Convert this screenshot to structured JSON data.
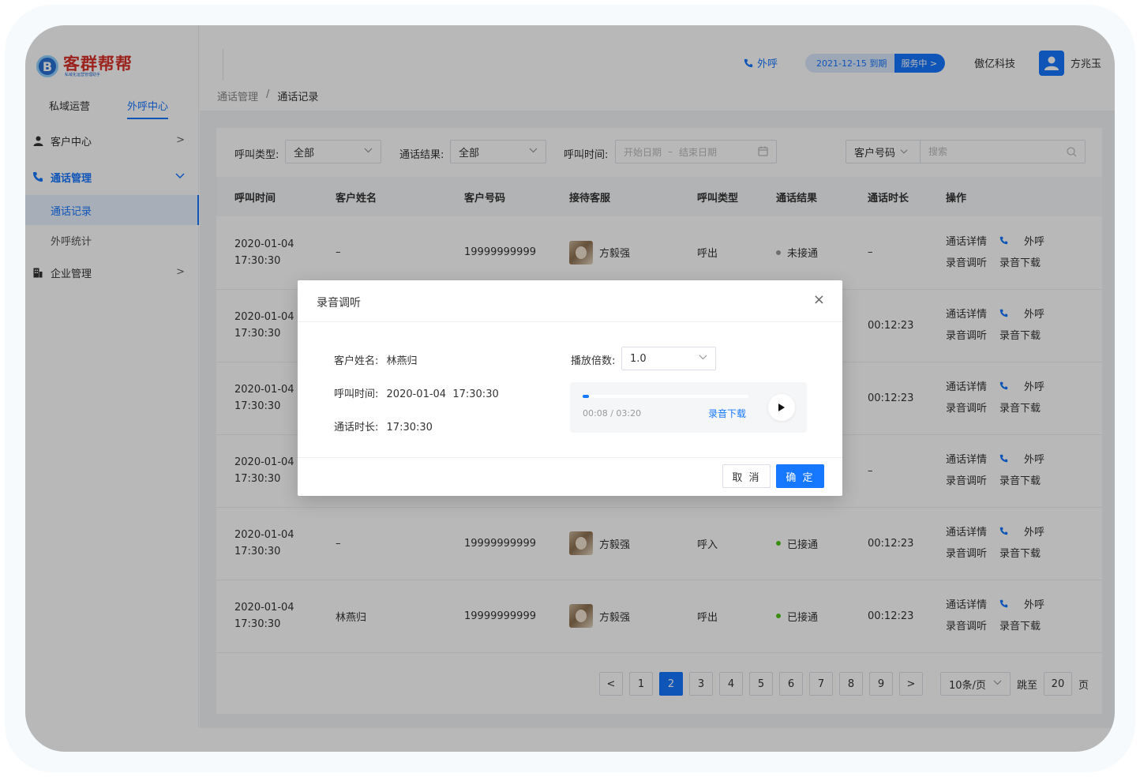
{
  "brand": {
    "title": "客群帮帮",
    "subtitle": "私域化运营管理助手",
    "mark": "B"
  },
  "top_tabs": [
    {
      "label": "私域运营"
    },
    {
      "label": "外呼中心"
    }
  ],
  "menu": {
    "customer_center": "客户中心",
    "call_management": "通话管理",
    "call_records": "通话记录",
    "outbound_stats": "外呼统计",
    "enterprise_management": "企业管理"
  },
  "header": {
    "call_label": "外呼",
    "expire_text": "2021-12-15  到期",
    "service_label": "服务中 >",
    "company": "傲亿科技",
    "user": "方兆玉"
  },
  "breadcrumb": {
    "parent": "通话管理",
    "sep": "/",
    "current": "通话记录"
  },
  "filters": {
    "call_type_label": "呼叫类型:",
    "call_type_value": "全部",
    "result_label": "通话结果:",
    "result_value": "全部",
    "time_label": "呼叫时间:",
    "start_placeholder": "开始日期",
    "date_sep": "–",
    "end_placeholder": "结束日期",
    "search_type": "客户号码",
    "search_placeholder": "搜索"
  },
  "table": {
    "columns": [
      "呼叫时间",
      "客户姓名",
      "客户号码",
      "接待客服",
      "呼叫类型",
      "通话结果",
      "通话时长",
      "操作"
    ],
    "rows": [
      {
        "date": "2020-01-04",
        "time": "17:30:30",
        "name": "–",
        "phone": "19999999999",
        "agent": "方毅强",
        "type": "呼出",
        "result": "未接通",
        "result_color": "#999999",
        "duration": "–"
      },
      {
        "date": "2020-01-04",
        "time": "17:30:30",
        "name": "",
        "phone": "",
        "agent": "",
        "type": "",
        "result": "",
        "result_color": "",
        "duration": "00:12:23"
      },
      {
        "date": "2020-01-04",
        "time": "17:30:30",
        "name": "",
        "phone": "",
        "agent": "",
        "type": "",
        "result": "",
        "result_color": "",
        "duration": "00:12:23"
      },
      {
        "date": "2020-01-04",
        "time": "17:30:30",
        "name": "",
        "phone": "",
        "agent": "",
        "type": "",
        "result": "",
        "result_color": "",
        "duration": "–"
      },
      {
        "date": "2020-01-04",
        "time": "17:30:30",
        "name": "–",
        "phone": "19999999999",
        "agent": "方毅强",
        "type": "呼入",
        "result": "已接通",
        "result_color": "#52c41a",
        "duration": "00:12:23"
      },
      {
        "date": "2020-01-04",
        "time": "17:30:30",
        "name": "林燕归",
        "phone": "19999999999",
        "agent": "方毅强",
        "type": "呼出",
        "result": "已接通",
        "result_color": "#52c41a",
        "duration": "00:12:23"
      }
    ],
    "actions": {
      "detail": "通话详情",
      "call": "外呼",
      "listen": "录音调听",
      "download": "录音下载"
    }
  },
  "pagination": {
    "prev": "<",
    "next": ">",
    "pages": [
      "1",
      "2",
      "3",
      "4",
      "5",
      "6",
      "7",
      "8",
      "9"
    ],
    "current": "2",
    "page_size": "10条/页",
    "jump_label": "跳至",
    "jump_value": "20",
    "page_suffix": "页"
  },
  "modal": {
    "title": "录音调听",
    "close": "×",
    "customer_name_label": "客户姓名:",
    "customer_name": "林燕归",
    "call_time_label": "呼叫时间:",
    "call_time": "2020-01-04  17:30:30",
    "duration_label": "通话时长:",
    "duration": "17:30:30",
    "speed_label": "播放倍数:",
    "speed_value": "1.0",
    "progress_text": "00:08 / 03:20",
    "progress_fraction": 0.04,
    "download": "录音下载",
    "cancel": "取 消",
    "confirm": "确 定"
  },
  "colors": {
    "accent": "#1677ff",
    "success": "#52c41a",
    "muted": "#999999",
    "brand_red": "#d9302a"
  }
}
